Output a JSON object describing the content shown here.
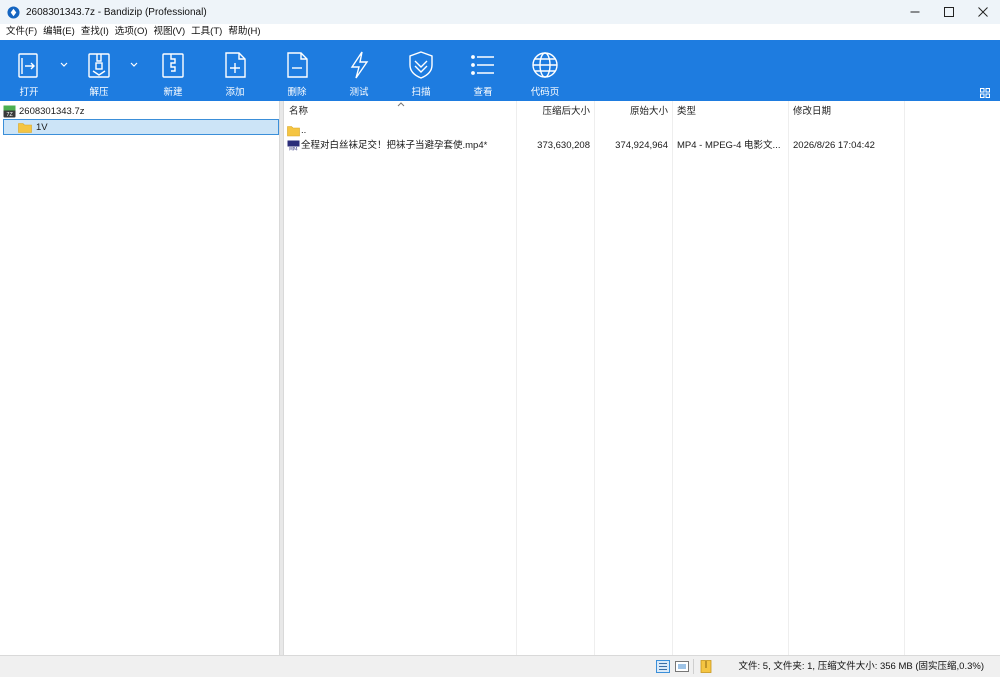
{
  "window": {
    "title": "2608301343.7z - Bandizip (Professional)"
  },
  "menu": [
    {
      "label": "文件(F)"
    },
    {
      "label": "编辑(E)"
    },
    {
      "label": "查找(I)"
    },
    {
      "label": "选项(O)"
    },
    {
      "label": "视图(V)"
    },
    {
      "label": "工具(T)"
    },
    {
      "label": "帮助(H)"
    }
  ],
  "toolbar": {
    "background": "#1e7ce0",
    "buttons": [
      {
        "label": "打开",
        "icon": "open-archive-icon"
      },
      {
        "label": "解压",
        "icon": "extract-icon"
      },
      {
        "label": "新建",
        "icon": "new-archive-icon"
      },
      {
        "label": "添加",
        "icon": "add-file-icon"
      },
      {
        "label": "删除",
        "icon": "delete-file-icon"
      },
      {
        "label": "测试",
        "icon": "test-bolt-icon"
      },
      {
        "label": "扫描",
        "icon": "scan-shield-icon"
      },
      {
        "label": "查看",
        "icon": "view-list-icon"
      },
      {
        "label": "代码页",
        "icon": "codepage-globe-icon"
      }
    ]
  },
  "tree": {
    "root": {
      "label": "2608301343.7z",
      "icon": "7z-archive-icon"
    },
    "children": [
      {
        "label": "1V",
        "icon": "folder-icon",
        "selected": true
      }
    ]
  },
  "filelist": {
    "columns": [
      {
        "label": "名称"
      },
      {
        "label": "压缩后大小"
      },
      {
        "label": "原始大小"
      },
      {
        "label": "类型"
      },
      {
        "label": "修改日期"
      }
    ],
    "rows": [
      {
        "name": "..",
        "icon": "folder-up-icon",
        "packed": "",
        "size": "",
        "type": "",
        "modified": ""
      },
      {
        "name": "全程对白丝袜足交！把袜子当避孕套使.mp4*",
        "icon": "mp4-file-icon",
        "packed": "373,630,208",
        "size": "374,924,964",
        "type": "MP4 - MPEG-4 电影文...",
        "modified": "2026/8/26 17:04:42"
      }
    ]
  },
  "status": {
    "text": "文件: 5, 文件夹: 1, 压缩文件大小: 356 MB (固实压缩,0.3%)"
  }
}
